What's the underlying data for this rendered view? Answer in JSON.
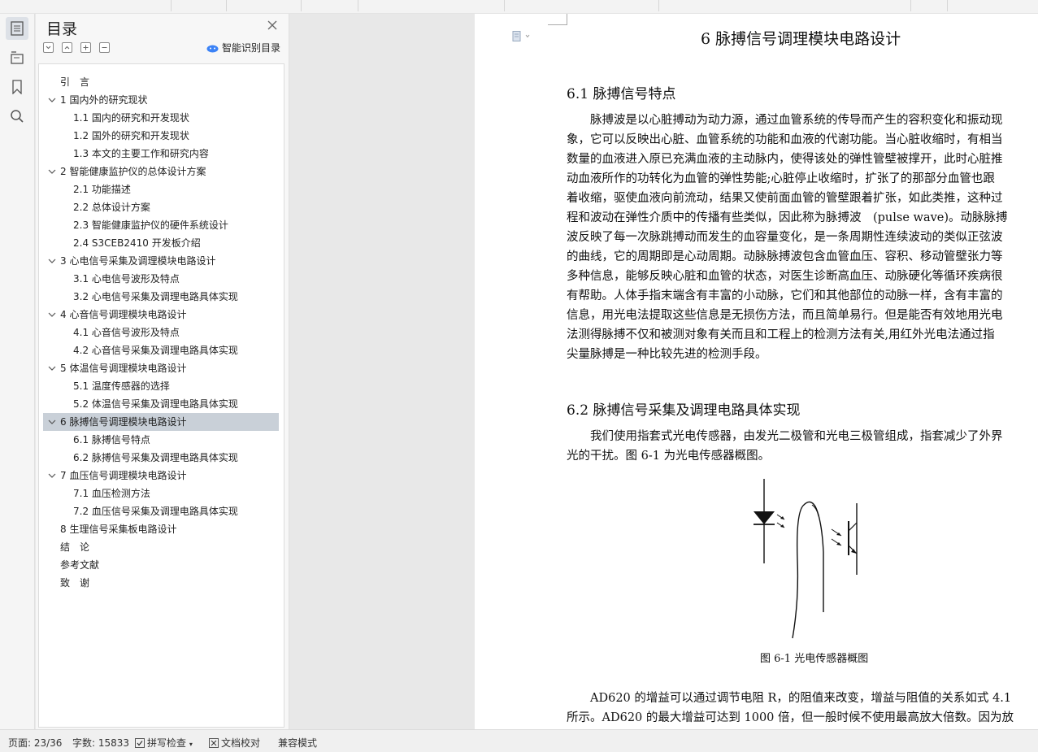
{
  "toc_panel": {
    "title": "目录",
    "smart_label": "智能识别目录",
    "items": [
      {
        "label": "引　言",
        "level": 0,
        "expandable": false,
        "selected": false
      },
      {
        "label": "1 国内外的研究现状",
        "level": 0,
        "expandable": true,
        "selected": false
      },
      {
        "label": "1.1 国内的研究和开发现状",
        "level": 1,
        "expandable": false,
        "selected": false
      },
      {
        "label": "1.2 国外的研究和开发现状",
        "level": 1,
        "expandable": false,
        "selected": false
      },
      {
        "label": "1.3 本文的主要工作和研究内容",
        "level": 1,
        "expandable": false,
        "selected": false
      },
      {
        "label": "2 智能健康监护仪的总体设计方案",
        "level": 0,
        "expandable": true,
        "selected": false
      },
      {
        "label": "2.1 功能描述",
        "level": 1,
        "expandable": false,
        "selected": false
      },
      {
        "label": "2.2 总体设计方案",
        "level": 1,
        "expandable": false,
        "selected": false
      },
      {
        "label": "2.3 智能健康监护仪的硬件系统设计",
        "level": 1,
        "expandable": false,
        "selected": false
      },
      {
        "label": "2.4 S3CEB2410 开发板介绍",
        "level": 1,
        "expandable": false,
        "selected": false
      },
      {
        "label": "3 心电信号采集及调理模块电路设计",
        "level": 0,
        "expandable": true,
        "selected": false
      },
      {
        "label": "3.1 心电信号波形及特点",
        "level": 1,
        "expandable": false,
        "selected": false
      },
      {
        "label": "3.2 心电信号采集及调理电路具体实现",
        "level": 1,
        "expandable": false,
        "selected": false
      },
      {
        "label": "4 心音信号调理模块电路设计",
        "level": 0,
        "expandable": true,
        "selected": false
      },
      {
        "label": "4.1 心音信号波形及特点",
        "level": 1,
        "expandable": false,
        "selected": false
      },
      {
        "label": "4.2 心音信号采集及调理电路具体实现",
        "level": 1,
        "expandable": false,
        "selected": false
      },
      {
        "label": "5 体温信号调理模块电路设计",
        "level": 0,
        "expandable": true,
        "selected": false
      },
      {
        "label": "5.1 温度传感器的选择",
        "level": 1,
        "expandable": false,
        "selected": false
      },
      {
        "label": "5.2 体温信号采集及调理电路具体实现",
        "level": 1,
        "expandable": false,
        "selected": false
      },
      {
        "label": "6 脉搏信号调理模块电路设计",
        "level": 0,
        "expandable": true,
        "selected": true
      },
      {
        "label": "6.1 脉搏信号特点",
        "level": 1,
        "expandable": false,
        "selected": false
      },
      {
        "label": "6.2 脉搏信号采集及调理电路具体实现",
        "level": 1,
        "expandable": false,
        "selected": false
      },
      {
        "label": "7 血压信号调理模块电路设计",
        "level": 0,
        "expandable": true,
        "selected": false
      },
      {
        "label": "7.1 血压检测方法",
        "level": 1,
        "expandable": false,
        "selected": false
      },
      {
        "label": "7.2 血压信号采集及调理电路具体实现",
        "level": 1,
        "expandable": false,
        "selected": false
      },
      {
        "label": "8 生理信号采集板电路设计",
        "level": 0,
        "expandable": false,
        "selected": false
      },
      {
        "label": "结　论",
        "level": 0,
        "expandable": false,
        "selected": false
      },
      {
        "label": "参考文献",
        "level": 0,
        "expandable": false,
        "selected": false
      },
      {
        "label": "致　谢",
        "level": 0,
        "expandable": false,
        "selected": false
      }
    ]
  },
  "document": {
    "chapter_title": "6 脉搏信号调理模块电路设计",
    "section1_title": "6.1 脉搏信号特点",
    "section1_lines": [
      "　　脉搏波是以心脏搏动为动力源，通过血管系统的传导而产生的容积变化和振动现",
      "象，它可以反映出心脏、血管系统的功能和血液的代谢功能。当心脏收缩时，有相当",
      "数量的血液进入原已充满血液的主动脉内，使得该处的弹性管壁被撑开，此时心脏推",
      "动血液所作的功转化为血管的弹性势能;心脏停止收缩时，扩张了的那部分血管也跟",
      "着收缩，驱使血液向前流动，结果又使前面血管的管壁跟着扩张，如此类推，这种过",
      "程和波动在弹性介质中的传播有些类似，因此称为脉搏波　(pulse wave)。动脉脉搏",
      "波反映了每一次脉跳搏动而发生的血容量变化，是一条周期性连续波动的类似正弦波",
      "的曲线，它的周期即是心动周期。动脉脉搏波包含血管血压、容积、移动管壁张力等",
      "多种信息，能够反映心脏和血管的状态，对医生诊断高血压、动脉硬化等循环疾病很",
      "有帮助。人体手指末端含有丰富的小动脉，它们和其他部位的动脉一样，含有丰富的",
      "信息，用光电法提取这些信息是无损伤方法，而且简单易行。但是能否有效地用光电",
      "法测得脉搏不仅和被测对象有关而且和工程上的检测方法有关,用红外光电法通过指",
      "尖量脉搏是一种比较先进的检测手段。"
    ],
    "section2_title": "6.2 脉搏信号采集及调理电路具体实现",
    "section2_lines": [
      "　　我们使用指套式光电传感器，由发光二极管和光电三极管组成，指套减少了外界",
      "光的干扰。图 6-1 为光电传感器概图。"
    ],
    "figure_caption": "图 6-1 光电传感器概图",
    "section3_lines": [
      "　　AD620 的增益可以通过调节电阻 R，的阻值来改变，增益与阻值的关系如式 4.1",
      "所示。AD620 的最大增益可达到 1000 倍，但一般时候不使用最高放大倍数。因为放"
    ]
  },
  "status_bar": {
    "page": "页面: 23/36",
    "word_count": "字数: 15833",
    "spell_check": "拼写检查",
    "doc_proof": "文档校对",
    "compat_mode": "兼容模式"
  }
}
